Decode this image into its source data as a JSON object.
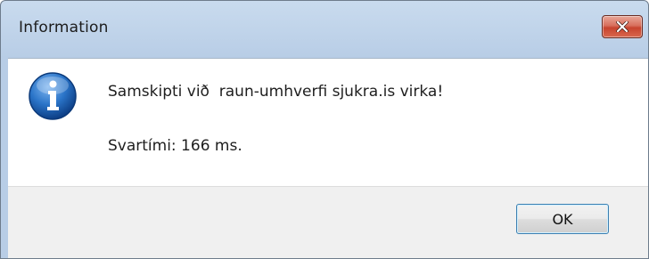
{
  "window": {
    "title": "Information",
    "close_icon": "close-icon"
  },
  "content": {
    "icon": "info-icon",
    "message": "Samskipti við  raun-umhverfi sjukra.is virka!",
    "detail": "Svartími: 166 ms."
  },
  "footer": {
    "ok_label": "OK"
  },
  "colors": {
    "titlebar": "#c9dbee",
    "close_button": "#c7432e",
    "icon_blue": "#1b5fb5",
    "footer_bg": "#f0f0f0",
    "button_border": "#3c7fb1"
  }
}
